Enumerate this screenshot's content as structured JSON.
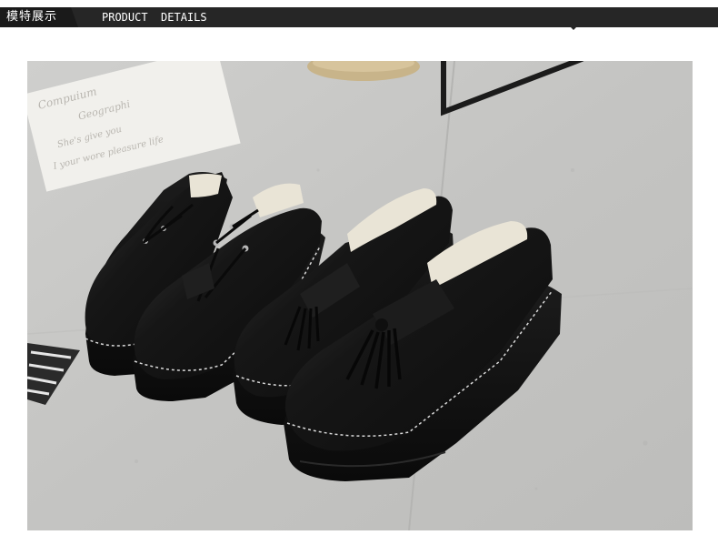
{
  "header": {
    "title_cn": "模特展示",
    "title_en": "PRODUCT  DETAILS"
  },
  "photo": {
    "subject": "two pairs of black platform shoes (lace-up oxfords and tassel loafers) on grey stone floor",
    "card_lines": [
      "Compuium",
      "Geographi",
      "She's give you",
      "I your wore pleasure life"
    ]
  },
  "colors": {
    "header_bg": "#262626",
    "header_tab": "#1a1a1a",
    "header_text": "#ffffff",
    "floor": "#c7c7c5",
    "leather": "#141414"
  },
  "icons": [
    "chevron-down-icon"
  ]
}
